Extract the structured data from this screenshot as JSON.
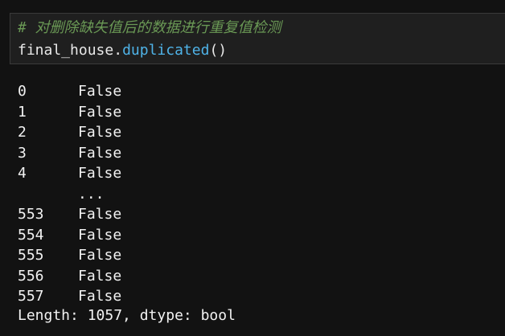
{
  "cell": {
    "comment": "# 对删除缺失值后的数据进行重复值检测",
    "code_object": "final_house",
    "code_dot": ".",
    "code_method": "duplicated",
    "code_parens": "()"
  },
  "output": {
    "rows": [
      {
        "index": "0",
        "value": "False"
      },
      {
        "index": "1",
        "value": "False"
      },
      {
        "index": "2",
        "value": "False"
      },
      {
        "index": "3",
        "value": "False"
      },
      {
        "index": "4",
        "value": "False"
      },
      {
        "index": "",
        "value": "..."
      },
      {
        "index": "553",
        "value": "False"
      },
      {
        "index": "554",
        "value": "False"
      },
      {
        "index": "555",
        "value": "False"
      },
      {
        "index": "556",
        "value": "False"
      },
      {
        "index": "557",
        "value": "False"
      }
    ],
    "footer": "Length: 1057, dtype: bool"
  },
  "colors": {
    "background": "#121212",
    "cell_background": "#1f1f1f",
    "comment": "#6a9955",
    "method": "#4fb3e8",
    "text": "#e8e8e8"
  }
}
